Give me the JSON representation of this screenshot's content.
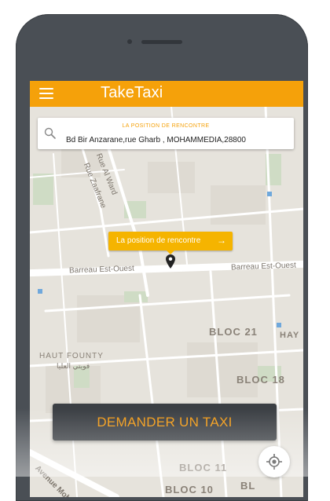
{
  "app": {
    "title": "TakeTaxi"
  },
  "search": {
    "label": "LA POSITION DE RENCONTRE",
    "address": "Bd Bir Anzarane,rue Gharb , MOHAMMEDIA,28800"
  },
  "pickup": {
    "label": "La position de rencontre",
    "arrow": "→"
  },
  "map": {
    "streets": [
      "Rue Al Ward",
      "Rue Zaafrane",
      "Barreau Est-Ouest",
      "Barreau Est-Ouest",
      "Avenue Moh"
    ],
    "areas": [
      "HAUT FOUNTY",
      "فويتي العليا",
      "BLOC 21",
      "BLOC 18",
      "BLOC 11",
      "BLOC 10",
      "HAY",
      "BL"
    ]
  },
  "cta": {
    "label": "DEMANDER UN TAXI"
  },
  "colors": {
    "accent": "#f5a10a",
    "cta_bg": "#3b3f44",
    "cta_text": "#f39a12",
    "map_bg": "#e6e3dc"
  },
  "icons": {
    "menu": "hamburger-menu-icon",
    "search": "search-icon",
    "pin": "map-pin-icon",
    "locate": "my-location-icon"
  }
}
